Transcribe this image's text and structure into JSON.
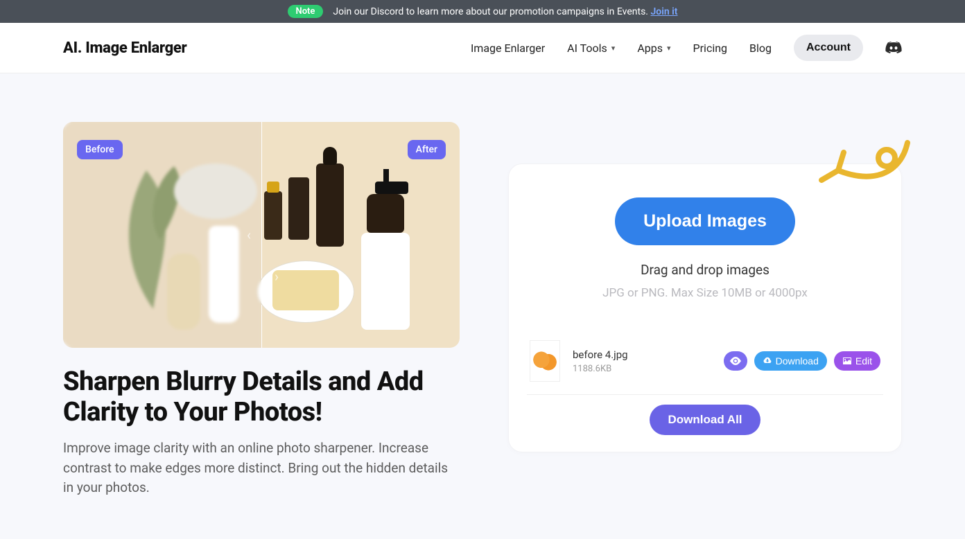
{
  "banner": {
    "note_badge": "Note",
    "text": "Join our Discord to learn more about our promotion campaigns in Events.",
    "link_text": "Join it"
  },
  "header": {
    "logo": "AI. Image Enlarger",
    "nav": {
      "image_enlarger": "Image Enlarger",
      "ai_tools": "AI Tools",
      "apps": "Apps",
      "pricing": "Pricing",
      "blog": "Blog",
      "account": "Account"
    }
  },
  "preview": {
    "before_label": "Before",
    "after_label": "After"
  },
  "hero": {
    "headline": "Sharpen Blurry Details and Add Clarity to Your Photos!",
    "subtext": "Improve image clarity with an online photo sharpener. Increase contrast to make edges more distinct. Bring out the hidden details in your photos."
  },
  "uploader": {
    "button": "Upload Images",
    "drop_text": "Drag and drop images",
    "hint": "JPG or PNG. Max Size 10MB or 4000px",
    "file": {
      "name": "before 4.jpg",
      "size": "1188.6KB"
    },
    "actions": {
      "download": "Download",
      "edit": "Edit"
    },
    "download_all": "Download All"
  }
}
